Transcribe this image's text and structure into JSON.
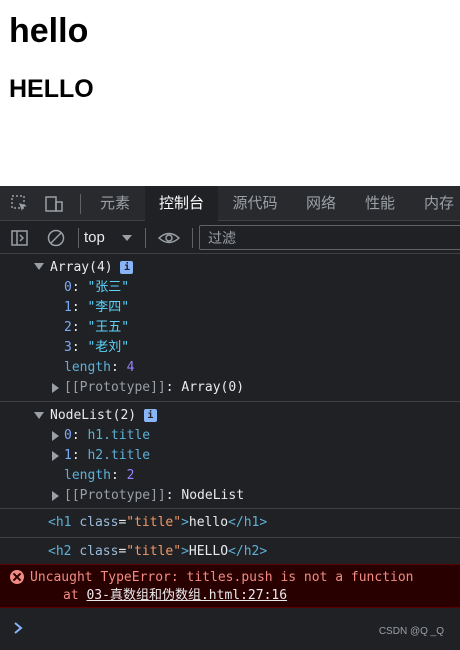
{
  "page": {
    "h1": "hello",
    "h2": "HELLO"
  },
  "tabs": [
    "元素",
    "控制台",
    "源代码",
    "网络",
    "性能",
    "内存"
  ],
  "active_tab": "控制台",
  "toolbar": {
    "context": "top",
    "filter_placeholder": "过滤"
  },
  "array_entry": {
    "summary_name": "Array(4)",
    "items": [
      {
        "key": "0",
        "value": "\"张三\""
      },
      {
        "key": "1",
        "value": "\"李四\""
      },
      {
        "key": "2",
        "value": "\"王五\""
      },
      {
        "key": "3",
        "value": "\"老刘\""
      }
    ],
    "length_key": "length",
    "length_value": "4",
    "proto_key": "[[Prototype]]",
    "proto_value": "Array(0)"
  },
  "nodelist_entry": {
    "summary_name": "NodeList(2)",
    "items": [
      {
        "key": "0",
        "value": "h1.title"
      },
      {
        "key": "1",
        "value": "h2.title"
      }
    ],
    "length_key": "length",
    "length_value": "2",
    "proto_key": "[[Prototype]]",
    "proto_value": "NodeList"
  },
  "element_logs": [
    {
      "open_tag": "<h1",
      "attr": "class",
      "attr_value": "\"title\"",
      "text": "hello",
      "close_tag": "</h1>"
    },
    {
      "open_tag": "<h2",
      "attr": "class",
      "attr_value": "\"title\"",
      "text": "HELLO",
      "close_tag": "</h2>"
    }
  ],
  "error": {
    "message": "Uncaught TypeError: titles.push is not a function",
    "at": "at",
    "location": "03-真数组和伪数组.html:27:16"
  },
  "watermark": "CSDN @Q _Q",
  "colors": {
    "devtools_bg": "#202124",
    "error_bg": "#290000",
    "error_text": "#f28b82",
    "string": "#5cd5fb",
    "number": "#9980ff"
  }
}
